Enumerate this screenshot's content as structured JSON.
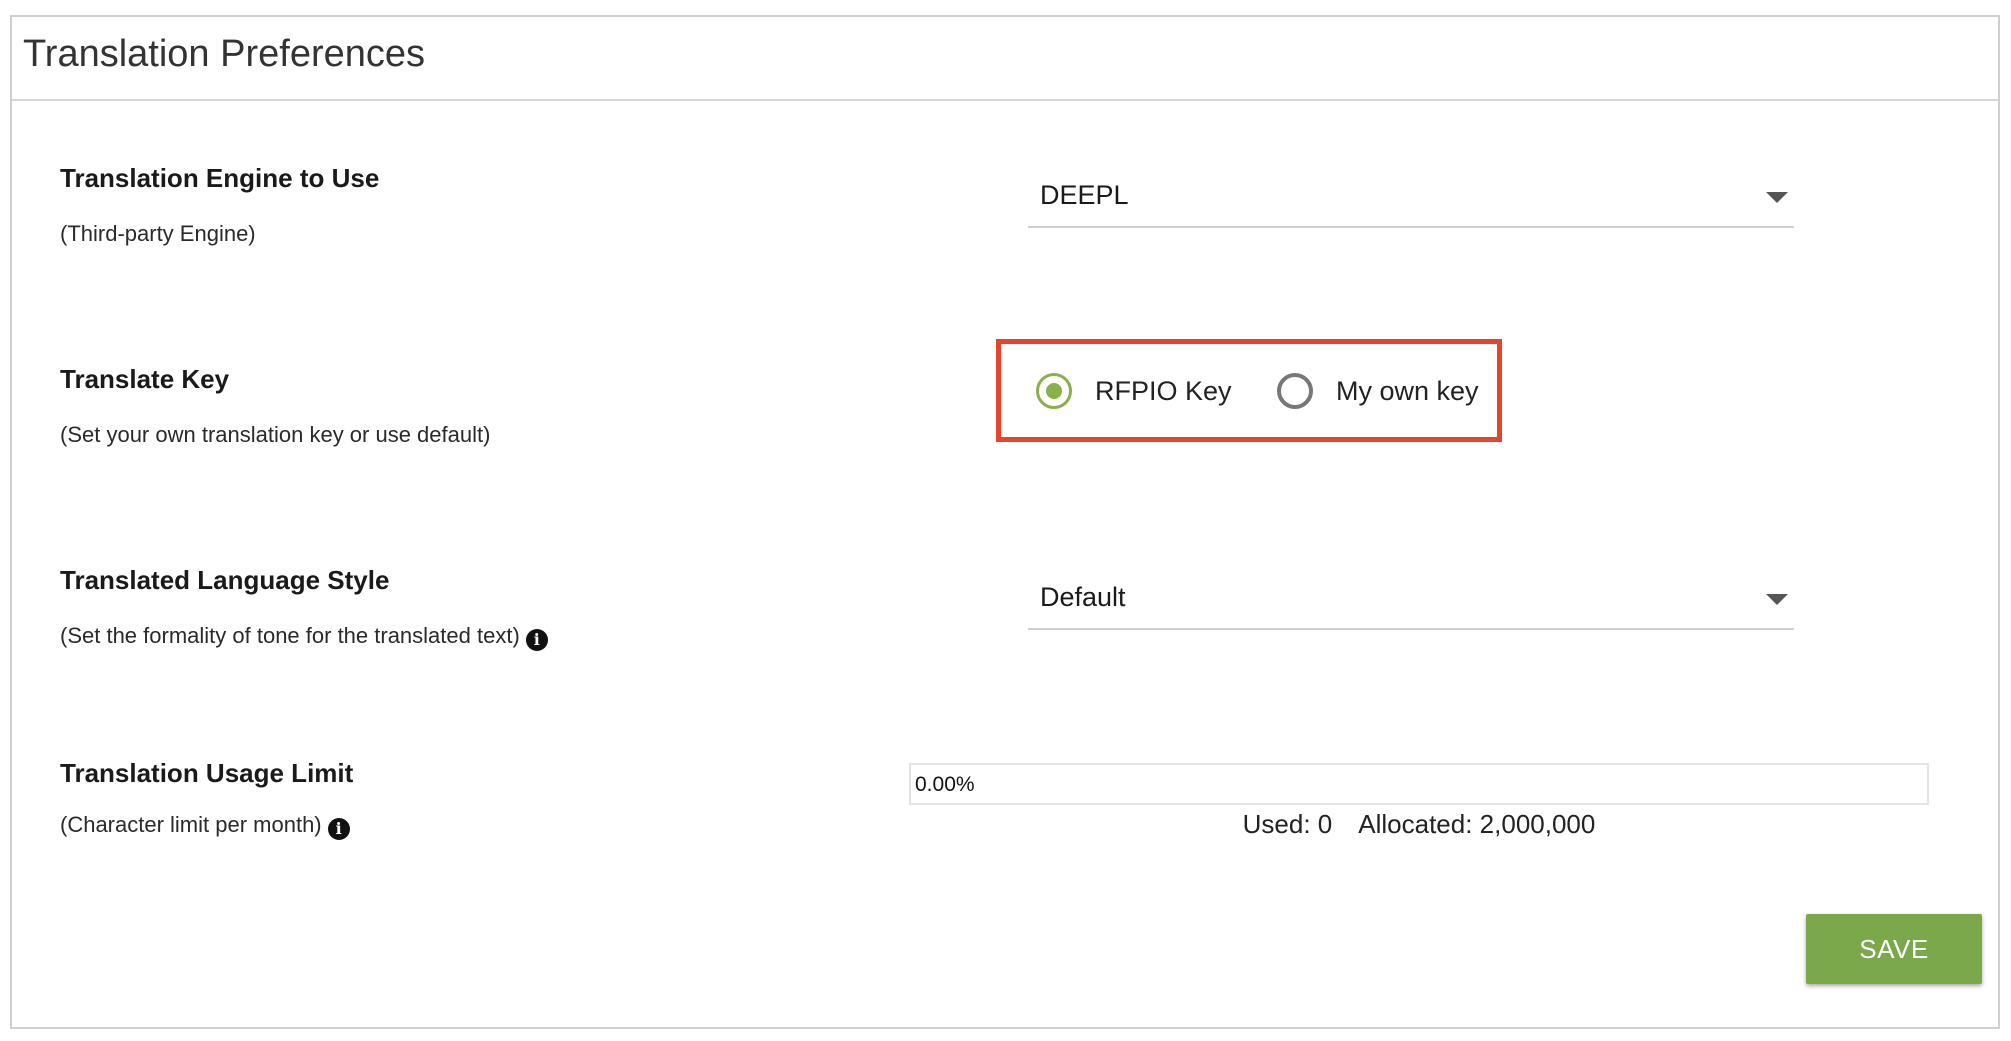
{
  "panel": {
    "title": "Translation Preferences"
  },
  "engine": {
    "label": "Translation Engine to Use",
    "sublabel": "(Third-party Engine)",
    "selected": "DEEPL"
  },
  "key": {
    "label": "Translate Key",
    "sublabel": "(Set your own translation key or use default)",
    "options": [
      {
        "label": "RFPIO Key",
        "selected": true
      },
      {
        "label": "My own key",
        "selected": false
      }
    ]
  },
  "style": {
    "label": "Translated Language Style",
    "sublabel": "(Set the formality of tone for the translated text)",
    "selected": "Default"
  },
  "usage": {
    "label": "Translation Usage Limit",
    "sublabel": "(Character limit per month)",
    "percent_text": "0.00%",
    "percent": 0,
    "used": "Used: 0",
    "allocated": "Allocated: 2,000,000"
  },
  "actions": {
    "save_label": "SAVE"
  },
  "colors": {
    "accent_green": "#8ab04a",
    "button_green": "#7aa84a",
    "highlight_red": "#e8432d"
  },
  "icons": {
    "info": "info-circle-icon",
    "caret": "caret-down-icon"
  }
}
